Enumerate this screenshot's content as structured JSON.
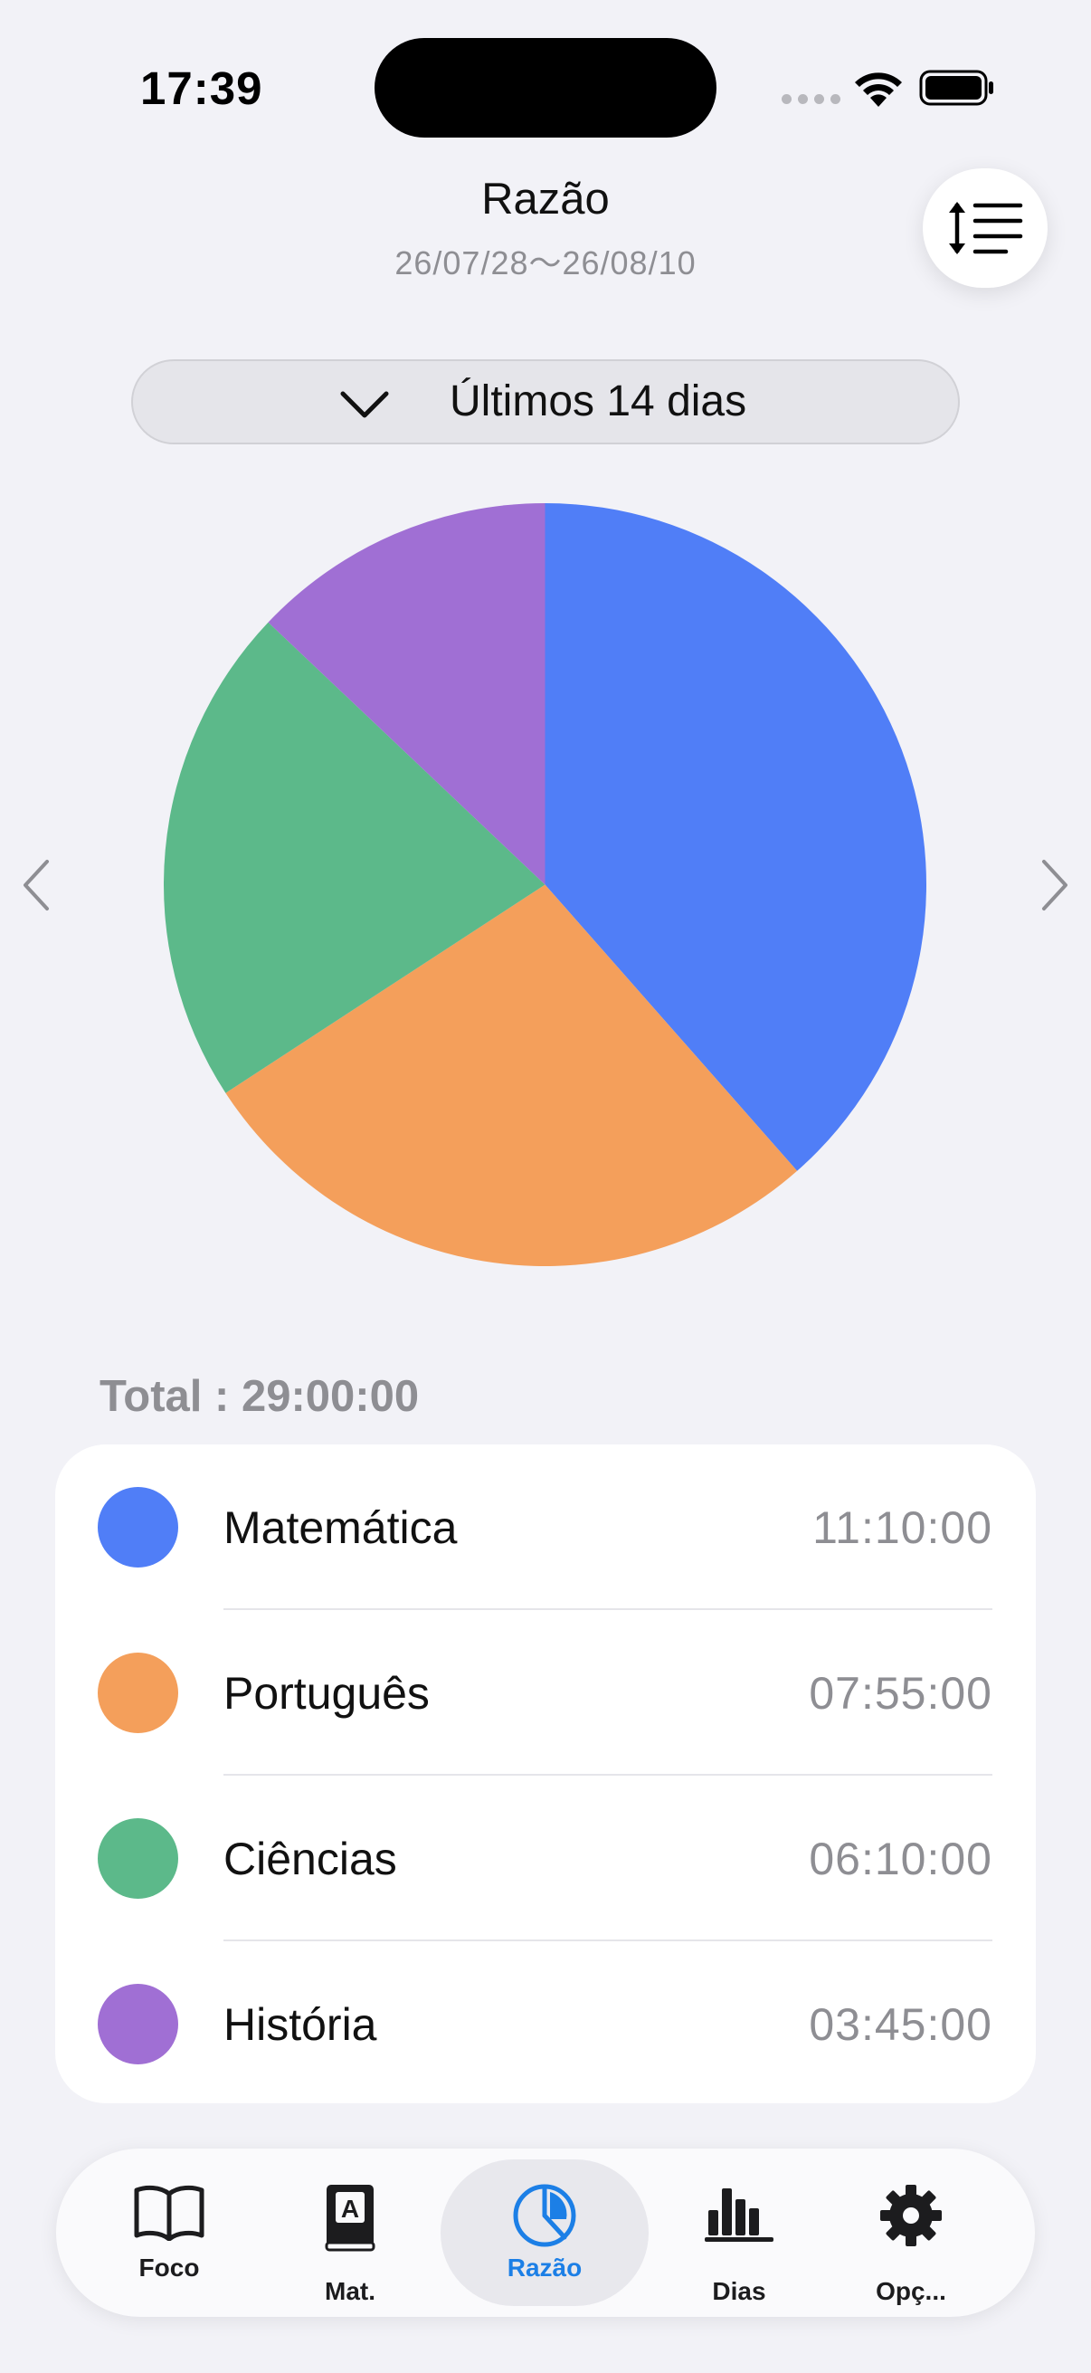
{
  "status_bar": {
    "time": "17:39"
  },
  "header": {
    "title": "Razão",
    "date_range": "26/07/28～26/08/10"
  },
  "period_selector": {
    "label": "Últimos 14 dias"
  },
  "total": {
    "label": "Total : 29:00:00"
  },
  "colors": {
    "matematica": "#507ef7",
    "portugues": "#f49f5b",
    "ciencias": "#5cb98a",
    "historia": "#a06fd4",
    "accent": "#1c7fe6"
  },
  "subjects": [
    {
      "name": "Matemática",
      "time": "11:10:00",
      "color": "#507ef7"
    },
    {
      "name": "Português",
      "time": "07:55:00",
      "color": "#f49f5b"
    },
    {
      "name": "Ciências",
      "time": "06:10:00",
      "color": "#5cb98a"
    },
    {
      "name": "História",
      "time": "03:45:00",
      "color": "#a06fd4"
    }
  ],
  "chart_data": {
    "type": "pie",
    "categories": [
      "Matemática",
      "Português",
      "Ciências",
      "História"
    ],
    "values": [
      670,
      475,
      370,
      225
    ],
    "colors": [
      "#507ef7",
      "#f49f5b",
      "#5cb98a",
      "#a06fd4"
    ]
  },
  "tabs": [
    {
      "label": "Foco",
      "icon": "book-open-icon",
      "active": false
    },
    {
      "label": "Mat.",
      "icon": "dictionary-icon",
      "active": false
    },
    {
      "label": "Razão",
      "icon": "pie-chart-icon",
      "active": true
    },
    {
      "label": "Dias",
      "icon": "bar-chart-icon",
      "active": false
    },
    {
      "label": "Opç...",
      "icon": "gear-icon",
      "active": false
    }
  ]
}
